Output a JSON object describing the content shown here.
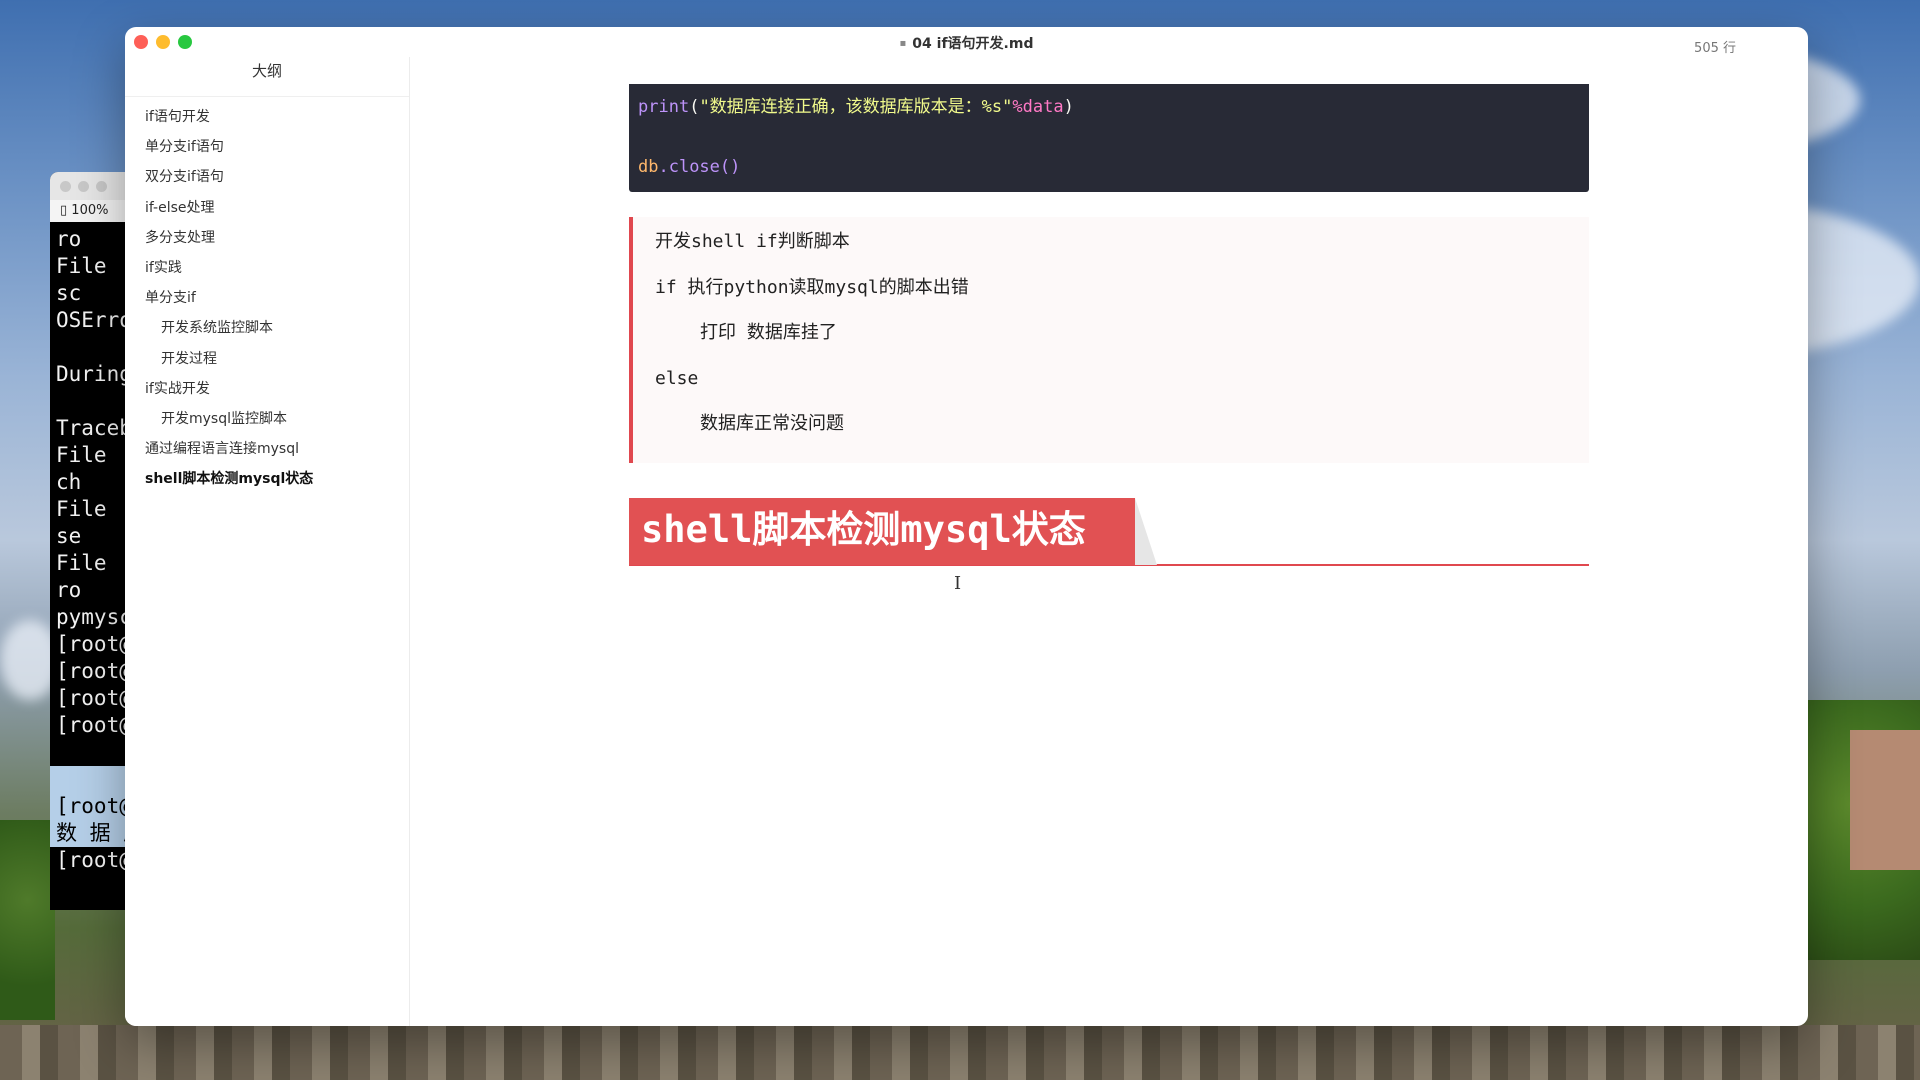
{
  "window": {
    "title": "04 if语句开发.md",
    "line_count": "505 行"
  },
  "sidebar": {
    "title": "大纲",
    "items": [
      {
        "label": "if语句开发",
        "level": 1
      },
      {
        "label": "单分支if语句",
        "level": 1
      },
      {
        "label": "双分支if语句",
        "level": 1
      },
      {
        "label": "if-else处理",
        "level": 1
      },
      {
        "label": "多分支处理",
        "level": 1
      },
      {
        "label": "if实践",
        "level": 1
      },
      {
        "label": "单分支if",
        "level": 1
      },
      {
        "label": "开发系统监控脚本",
        "level": 2
      },
      {
        "label": "开发过程",
        "level": 2
      },
      {
        "label": "if实战开发",
        "level": 1
      },
      {
        "label": "开发mysql监控脚本",
        "level": 2
      },
      {
        "label": "通过编程语言连接mysql",
        "level": 1
      },
      {
        "label": "shell脚本检测mysql状态",
        "level": 1,
        "active": true
      }
    ]
  },
  "code": {
    "print_fn": "print",
    "print_open": "(",
    "print_str": "\"数据库连接正确，该数据库版本是：%s\"",
    "print_var": "%data",
    "print_close": ")",
    "close_obj": "db",
    "close_rest": ".close()"
  },
  "quote": {
    "lines": [
      "开发shell if判断脚本",
      "if 执行python读取mysql的脚本出错",
      "打印 数据库挂了",
      "else",
      "数据库正常没问题"
    ]
  },
  "heading": {
    "text": "shell脚本检测mysql状态"
  },
  "terminal": {
    "zoom": "100%",
    "lines": [
      "  ro",
      "  File",
      "    sc",
      "OSErro",
      "",
      "During",
      "",
      "Traceb",
      "  File",
      "    ch",
      "  File",
      "    se",
      "  File",
      "    ro",
      "pymysc",
      "[root@",
      "[root@",
      "[root@",
      "[root@",
      "",
      "",
      "[root@",
      "数 据 库",
      "[root@"
    ]
  },
  "colors": {
    "accent_red": "#e15153",
    "code_bg": "#282a36"
  }
}
